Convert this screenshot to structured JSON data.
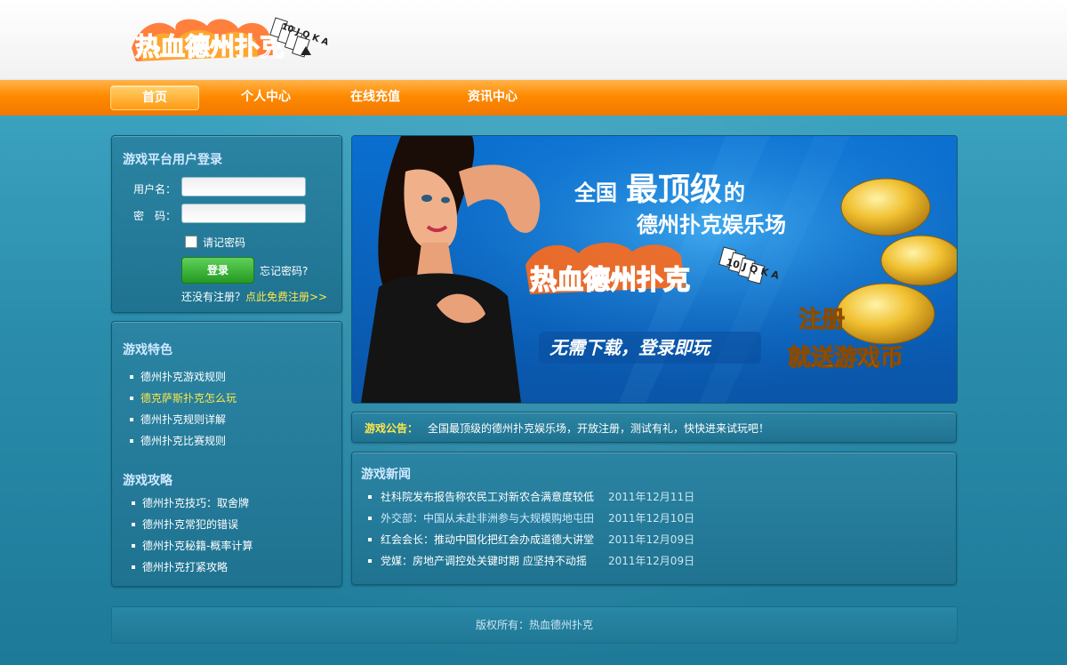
{
  "logo": {
    "text": "热血德州扑克",
    "cards": "10 J Q K A"
  },
  "nav": [
    {
      "label": "首页"
    },
    {
      "label": "个人中心"
    },
    {
      "label": "在线充值"
    },
    {
      "label": "资讯中心"
    }
  ],
  "login": {
    "title": "游戏平台用户登录",
    "username_label": "用户名：",
    "password_label": "密　码：",
    "username_value": "",
    "password_value": "",
    "remember_label": "请记密码",
    "login_button": "登录",
    "forgot_link": "忘记密码?",
    "no_account": "还没有注册？",
    "register_link": "点此免费注册>>"
  },
  "features": {
    "title": "游戏特色",
    "items": [
      "德州扑克游戏规则",
      "德克萨斯扑克怎么玩",
      "德州扑克规则详解",
      "德州扑克比赛规则"
    ]
  },
  "strategy": {
    "title": "游戏攻略",
    "items": [
      "德州扑克技巧：取舍牌",
      "德州扑克常犯的错误",
      "德州扑克秘籍-概率计算",
      "德州扑克打紧攻略"
    ]
  },
  "banner": {
    "line1a": "全国",
    "line1b": "最顶级",
    "line1c": "的",
    "line2": "德州扑克娱乐场",
    "logo_text": "热血德州扑克",
    "cards": "10 J Q K A",
    "slogan": "无需下载，登录即玩",
    "promo1": "注册",
    "promo2": "就送游戏币"
  },
  "notice": {
    "label": "游戏公告：",
    "text": "全国最顶级的德州扑克娱乐场，开放注册，测试有礼，快快进来试玩吧！"
  },
  "news": {
    "title": "游戏新闻",
    "items": [
      {
        "title": "社科院发布报告称农民工对新农合满意度较低",
        "date": "2011年12月11日"
      },
      {
        "title": "外交部：中国从未赴非洲参与大规模购地屯田",
        "date": "2011年12月10日"
      },
      {
        "title": "红会会长：推动中国化把红会办成道德大讲堂",
        "date": "2011年12月09日"
      },
      {
        "title": "党媒：房地产调控处关键时期 应坚持不动摇",
        "date": "2011年12月09日"
      }
    ]
  },
  "footer": {
    "text": "版权所有：热血德州扑克"
  },
  "colors": {
    "accent_orange": "#ff8a00",
    "link_yellow": "#ffe84a",
    "panel_blue": "#1f7391"
  }
}
